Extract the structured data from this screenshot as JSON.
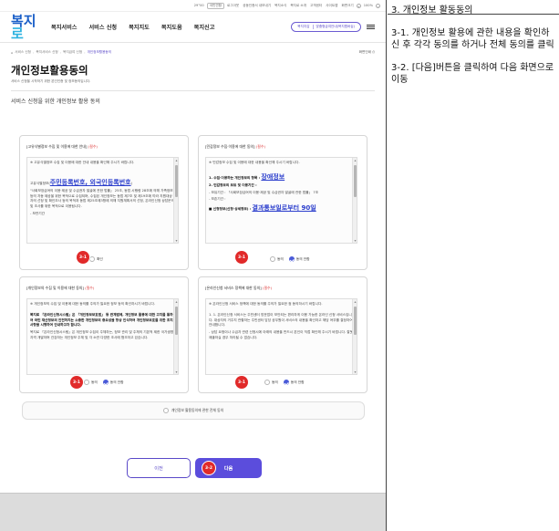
{
  "right_panel": {
    "title": "3. 개인정보 활동동의",
    "note1": "3-1. 개인정보 활용에 관한 내용을 확인하신 후 각각 동의를 하거나 전체 동의를 클릭",
    "note2": "3-2. [다음]버튼을 클릭하여 다음 화면으로 이동"
  },
  "utility_bar": {
    "items": [
      "29°00",
      "국민연합",
      "로그아웃",
      "공동인증서 내보내기",
      "복지소식",
      "복지로 소개",
      "고객센터",
      "사이트맵",
      "화면크기",
      "100%"
    ]
  },
  "header": {
    "logo_main": "복지",
    "logo_accent": "로",
    "nav": [
      "복지서비스",
      "서비스 신청",
      "복지지도",
      "복지도움",
      "복지신고"
    ],
    "pill_left": "복지지갑",
    "pill_right": "맞춤형급여안내(복지멤버십)"
  },
  "breadcrumb": {
    "items": [
      "서비스 신청",
      "복지서비스 신청",
      "복지급여 신청"
    ],
    "current": "개인정보활용동의",
    "print": "화면인쇄"
  },
  "page": {
    "title": "개인정보활용동의",
    "subtitle": "서비스 신청을 시작하기 위한 본인인증 및 정보동의입니다.",
    "section_title": "서비스 신청을 위한 개인정보 활용 동의"
  },
  "cards": [
    {
      "title": "[고유식별정보 수집 및 이용에 대한 안내]",
      "required": "(필수)",
      "text1": "※ 고유식별정보 수집 및 이용에 대한 안내 내용을 확인해 주시기 바랍니다.",
      "label": "고유식별정보(",
      "big": "주민등록번호, 외국인등록번호",
      "label_end": ")",
      "text2": "\"사회보장급여의 이용·제공 및 수급권자 발굴에 관한 법률」 25조, 동법 시행령 28조에 의해 가족정보 등의 자동 제공을 위한 목적으로 수집되며, 수집된 개인정보는 동법 제7조 및 제19조에 따라 지원대상자의 선정 및 확인조사 등의 목적과 동법 제25조제3항에 의해 지원계획서의 선정, 온라인신청 상담문의 및 조사를 위한 목적으로 이용됩니다.",
      "text3": "- 보관기간",
      "options": [
        "확인"
      ],
      "badge": "3-1"
    },
    {
      "title": "[민감정보 수집·이용에 대한 동의]",
      "required": "(필수)",
      "text1": "※ 민감정보 수집 및 이용에 대한 내용을 확인해 주시기 바랍니다.",
      "item1_label": "1. 수집·이용하는 개인정보의 항목 :",
      "big1": "장애정보",
      "item2": "2. 민감정보의 보유 및 이용기간 :",
      "item2_sub": "- 보유기간 : 「사회보장급여의 이용·제공 및 수급권자 발굴에 관한 법률」 7조",
      "text3": "- 보존기간 :",
      "item3_label": "■ 신청정보(신청·상세정보) :",
      "big2": "결과통보일로부터 90일",
      "options": [
        "동의",
        "동의 안함"
      ],
      "badge": "3-1"
    },
    {
      "title": "[개인정보의 수집 및 이용에 대한 동의]",
      "required": "(필수)",
      "text1": "※ 개인정보의 수집 및 이용에 대한 동의를 주의가 필요한 정보 등의 확인하시기 바랍니다.",
      "text2": "복지로 「온라인신청시스템」은 「개인정보보호법」 등 관계법에, 개인정보 활용에 대한 고지를 통하여 국민 재산정보의 안전하지는 소중한 개인정보의 중요성을 항상 인식하여 개인정보보호를 위한 조치사항을 시행하여 안내하고자 합니다.",
      "text3": "복지로 「온라인신청시스템」은 개인정보 수집이 주체하는, 정보 관리 및 주체의 기본적 제한 국가생명자격 개발하며 건강하는 개인정보 주체 및 각 소관 다양한 조사에 협조하고 있습니다.",
      "options": [
        "동의",
        "동의 안함"
      ],
      "badge": "3-1"
    },
    {
      "title": "[온라인신청 서비스 정책에 대한 동의]",
      "required": "(필수)",
      "text1": "※ 온라인신청 서비스 정책에 대한 동의를 주의가 필요한 점 동의하시기 바랍니다.",
      "text2": "1. 1. 온라인신청 서비스는 주민센터 방문없이 보안되는 편리하게 이용 가능한 온라인 신청 서비스입니다. 대상자의 거주지 관할하는 주민센터 담당 공무원이 서비스의 내용을 확인하고 해당 여부를 결정하여 안내합니다.",
      "text3": "- 상담 요청이나 수급자 관련 신청시에 아래의 내용을 반드시 본인이 직접 확인해 주시기 바랍니다. 잘못 제출하실 경우 처리될 수 없습니다.",
      "options": [
        "동의",
        "동의 안함"
      ],
      "badge": "3-1"
    }
  ],
  "all_agree": {
    "label": "개인정보 활용동의에 관한 전체 동의"
  },
  "buttons": {
    "prev": "이전",
    "next": "다음",
    "next_badge": "3-2"
  },
  "colors": {
    "accent": "#5b4ddc",
    "badge": "#e12a2a",
    "required": "#dd3333",
    "link": "#2a3dcc"
  }
}
